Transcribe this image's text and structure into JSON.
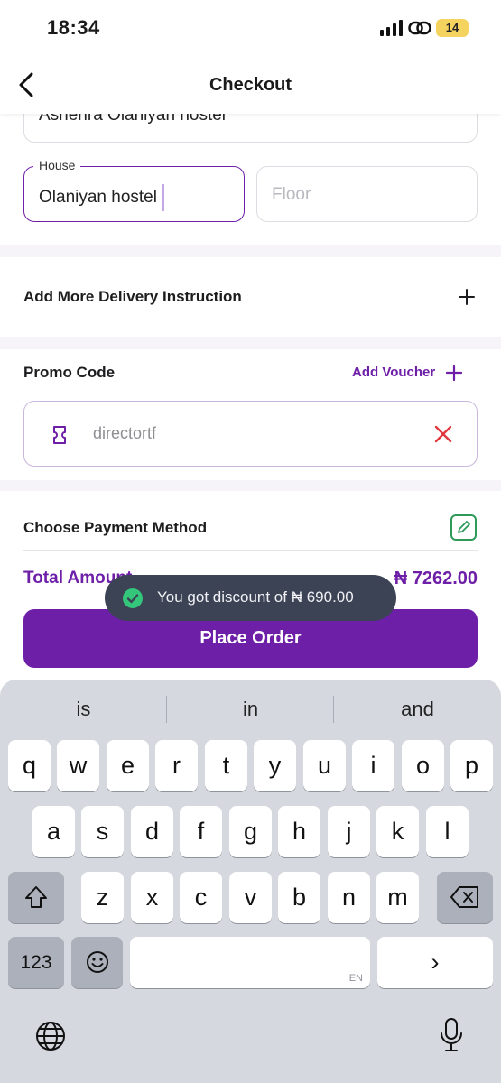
{
  "status_bar": {
    "time": "18:34",
    "battery": "14"
  },
  "nav": {
    "title": "Checkout"
  },
  "address": {
    "value": "Ashenra Olaniyan hostel"
  },
  "house": {
    "label": "House",
    "value": "Olaniyan hostel"
  },
  "floor": {
    "placeholder": "Floor"
  },
  "delivery": {
    "label": "Add More Delivery Instruction"
  },
  "promo": {
    "label": "Promo Code",
    "add_voucher": "Add Voucher",
    "code": "directortf"
  },
  "payment": {
    "label": "Choose Payment Method"
  },
  "total": {
    "label": "Total Amount",
    "value": "₦ 7262.00"
  },
  "toast": {
    "message": "You got discount of ₦ 690.00"
  },
  "place_order": {
    "label": "Place Order"
  },
  "keyboard": {
    "suggestions": [
      "is",
      "in",
      "and"
    ],
    "row1": [
      "q",
      "w",
      "e",
      "r",
      "t",
      "y",
      "u",
      "i",
      "o",
      "p"
    ],
    "row2": [
      "a",
      "s",
      "d",
      "f",
      "g",
      "h",
      "j",
      "k",
      "l"
    ],
    "row3": [
      "z",
      "x",
      "c",
      "v",
      "b",
      "n",
      "m"
    ],
    "numbers_key": "123",
    "space_lang": "EN",
    "return_key": "›"
  },
  "colors": {
    "accent": "#6e1fa8",
    "error": "#e0383e",
    "success": "#34c77b",
    "toast_bg": "#3b4355"
  }
}
